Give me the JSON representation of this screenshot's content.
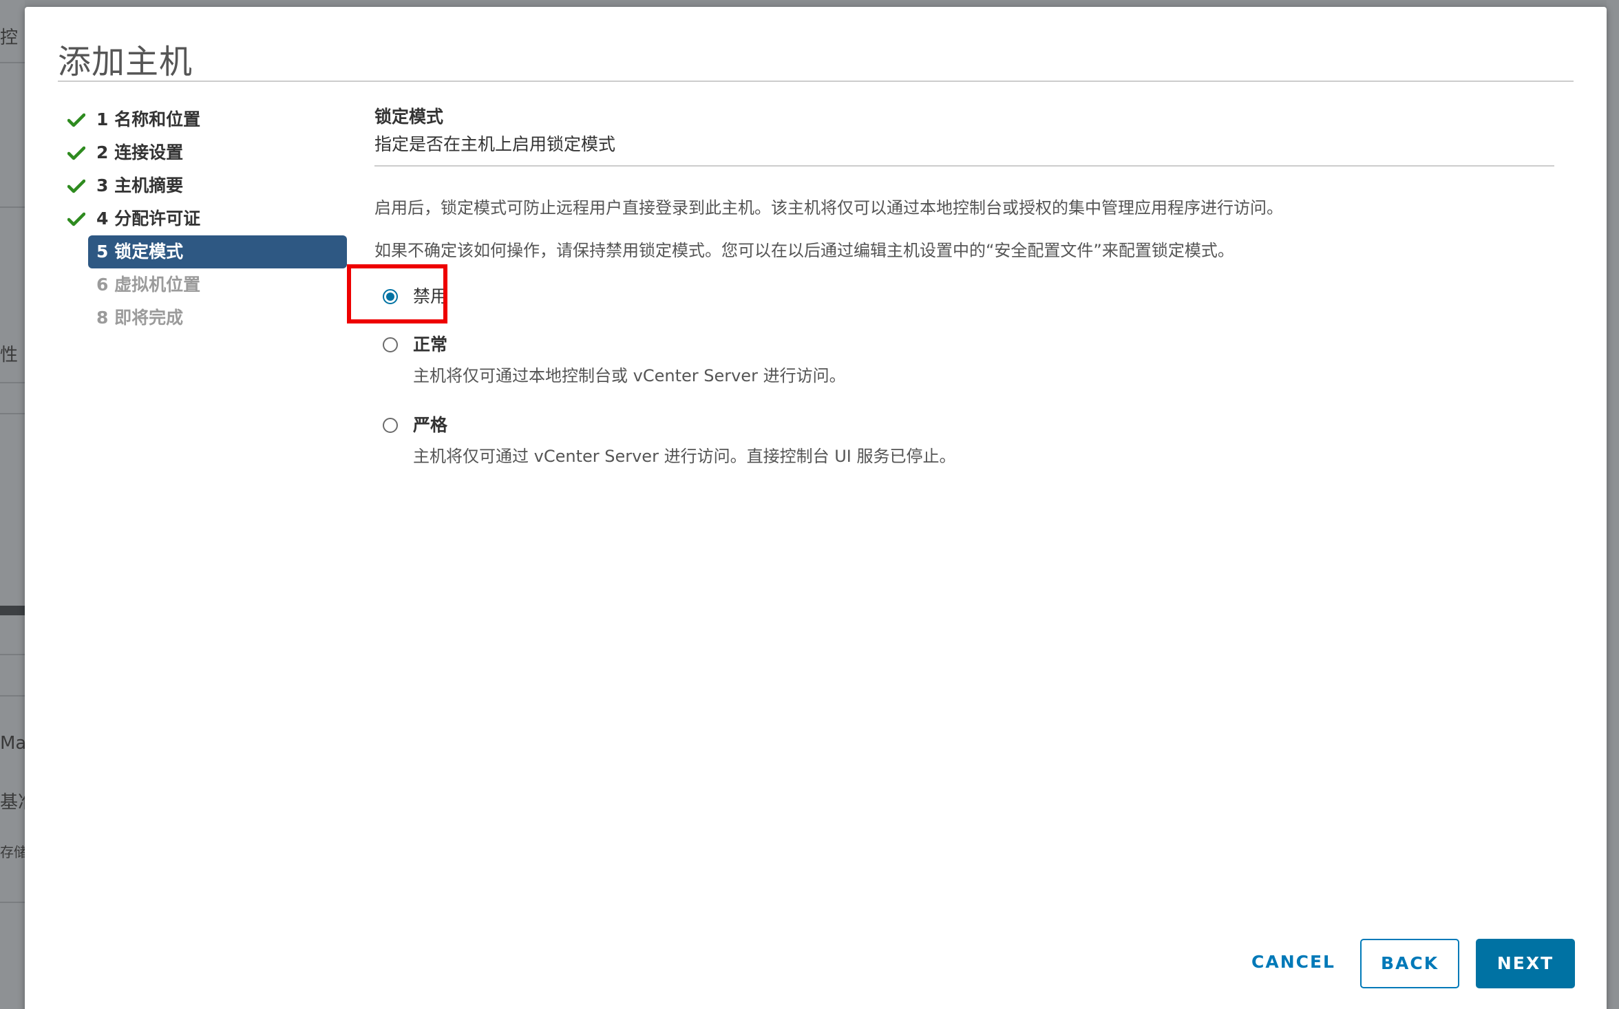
{
  "background": {
    "fragments": [
      "控",
      "性",
      "Ma",
      "基准",
      "存储"
    ]
  },
  "modal": {
    "title": "添加主机"
  },
  "steps": [
    {
      "number": "1",
      "label": "1 名称和位置",
      "state": "done"
    },
    {
      "number": "2",
      "label": "2 连接设置",
      "state": "done"
    },
    {
      "number": "3",
      "label": "3 主机摘要",
      "state": "done"
    },
    {
      "number": "4",
      "label": "4 分配许可证",
      "state": "done"
    },
    {
      "number": "5",
      "label": "5 锁定模式",
      "state": "active"
    },
    {
      "number": "6",
      "label": "6 虚拟机位置",
      "state": "disabled"
    },
    {
      "number": "8",
      "label": "8 即将完成",
      "state": "disabled"
    }
  ],
  "content": {
    "title": "锁定模式",
    "subtitle": "指定是否在主机上启用锁定模式",
    "paragraph1": "启用后，锁定模式可防止远程用户直接登录到此主机。该主机将仅可以通过本地控制台或授权的集中管理应用程序进行访问。",
    "paragraph2": "如果不确定该如何操作，请保持禁用锁定模式。您可以在以后通过编辑主机设置中的“安全配置文件”来配置锁定模式。",
    "options": [
      {
        "label": "禁用",
        "description": "",
        "checked": true
      },
      {
        "label": "正常",
        "description": "主机将仅可通过本地控制台或 vCenter Server 进行访问。",
        "checked": false
      },
      {
        "label": "严格",
        "description": "主机将仅可通过 vCenter Server 进行访问。直接控制台 UI 服务已停止。",
        "checked": false
      }
    ]
  },
  "buttons": {
    "cancel": "CANCEL",
    "back": "BACK",
    "next": "NEXT"
  },
  "colors": {
    "accent": "#0072a3",
    "active_step": "#2e5883",
    "check": "#2e8b1f",
    "highlight": "#ee0000"
  }
}
